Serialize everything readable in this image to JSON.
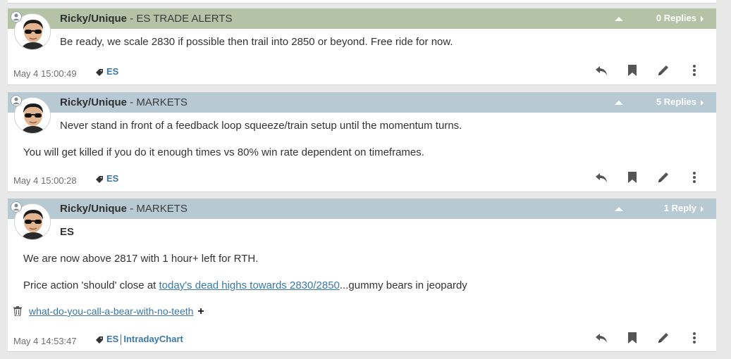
{
  "colors": {
    "header_green": "#b4c3a6",
    "header_blue": "#b7cad4",
    "link": "#3a78a8",
    "icon": "#555555"
  },
  "posts": [
    {
      "author": "Ricky/Unique",
      "channel": "- ES TRADE ALERTS",
      "replies": "0 Replies",
      "lines": [
        "Be ready, we scale 2830 if possible then trail into 2850 or beyond. Free ride for now."
      ],
      "time": "May 4 15:00:49",
      "tags": [
        "ES"
      ]
    },
    {
      "author": "Ricky/Unique",
      "channel": "- MARKETS",
      "replies": "5 Replies",
      "lines": [
        "Never stand in front of a feedback loop squeeze/train setup until the momentum turns.",
        "You will get killed if you do it enough times vs 80% win rate dependent on timeframes."
      ],
      "time": "May 4 15:00:28",
      "tags": [
        "ES"
      ]
    },
    {
      "author": "Ricky/Unique",
      "channel": "- MARKETS",
      "replies": "1 Reply",
      "subhead": "ES",
      "lines": [
        "We are now above 2817 with 1 hour+ left for RTH."
      ],
      "line2_prefix": "Price action 'should' close at ",
      "line2_link": "today's dead highs towards 2830/2850",
      "line2_suffix": "...gummy bears in jeopardy",
      "attachment": "what-do-you-call-a-bear-with-no-teeth",
      "attachment_add": "+",
      "time": "May 4 14:53:47",
      "tags": [
        "ES",
        "IntradayChart"
      ]
    }
  ],
  "icons": {
    "reply": "reply-icon",
    "bookmark": "bookmark-icon",
    "edit": "pencil-icon",
    "more": "more-vertical-icon",
    "tag": "tag-icon",
    "trash": "trash-icon",
    "user": "user-icon"
  }
}
